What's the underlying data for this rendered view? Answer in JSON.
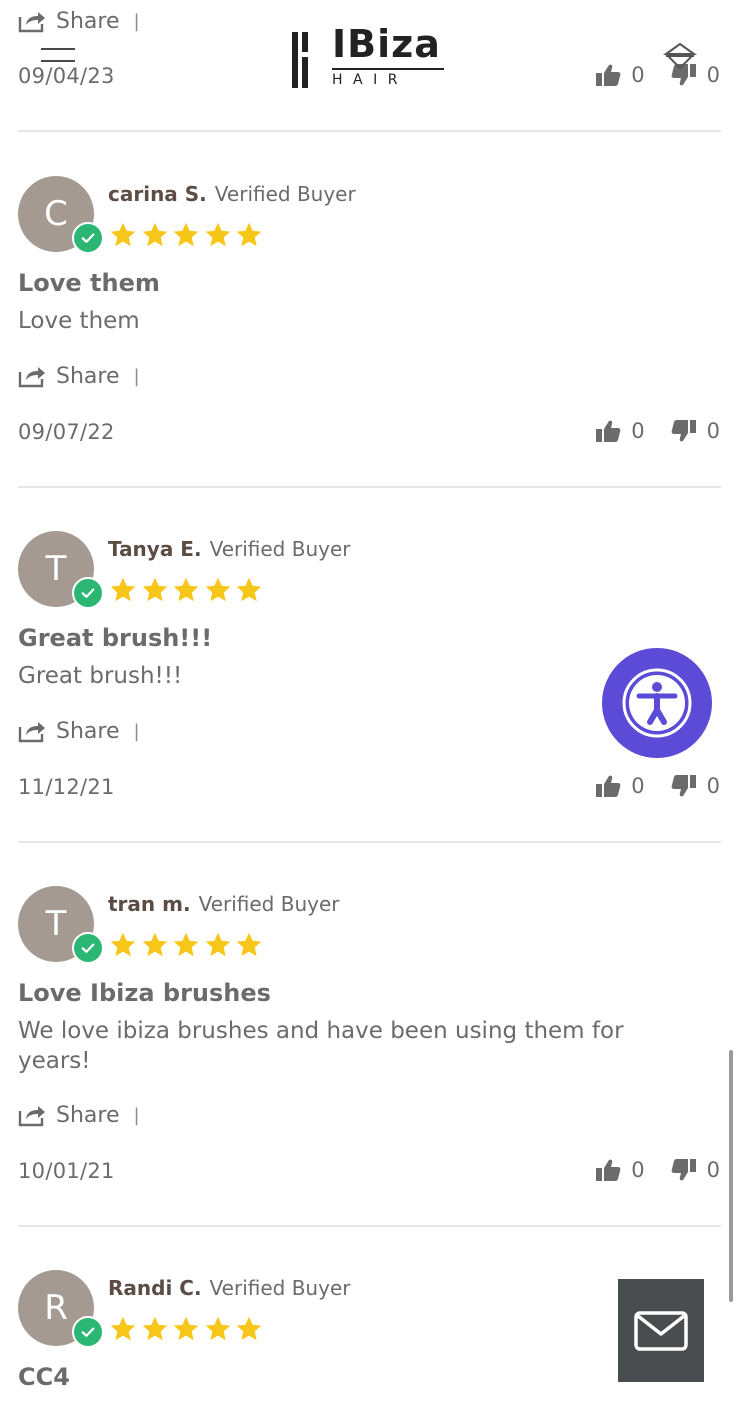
{
  "header": {
    "brand_word": "IBiza",
    "brand_sub": "HAIR"
  },
  "top_partial": {
    "share_label": "Share",
    "separator": "|",
    "date": "09/04/23",
    "likes": "0",
    "dislikes": "0"
  },
  "reviews": [
    {
      "initial": "C",
      "name": "carina S.",
      "badge": "Verified Buyer",
      "rating": 5,
      "title": "Love them",
      "body": "Love them",
      "share_label": "Share",
      "separator": "|",
      "date": "09/07/22",
      "likes": "0",
      "dislikes": "0"
    },
    {
      "initial": "T",
      "name": "Tanya E.",
      "badge": "Verified Buyer",
      "rating": 5,
      "title": "Great brush!!!",
      "body": "Great brush!!!",
      "share_label": "Share",
      "separator": "|",
      "date": "11/12/21",
      "likes": "0",
      "dislikes": "0"
    },
    {
      "initial": "T",
      "name": "tran m.",
      "badge": "Verified Buyer",
      "rating": 5,
      "title": "Love Ibiza brushes",
      "body": "We love ibiza brushes and have been using them for years!",
      "share_label": "Share",
      "separator": "|",
      "date": "10/01/21",
      "likes": "0",
      "dislikes": "0"
    },
    {
      "initial": "R",
      "name": "Randi C.",
      "badge": "Verified Buyer",
      "rating": 5,
      "title": "CC4"
    }
  ],
  "colors": {
    "star": "#f6c619",
    "verified": "#2bb673",
    "avatar": "#a49a92",
    "accessibility": "#5b4bd6",
    "mail_button": "#4a4d4f"
  },
  "icons": {
    "share": "share-icon",
    "like": "thumbs-up-icon",
    "dislike": "thumbs-down-icon",
    "verified": "check-icon",
    "accessibility": "accessibility-icon",
    "mail": "mail-icon",
    "cart": "cart-icon",
    "menu": "menu-icon"
  }
}
